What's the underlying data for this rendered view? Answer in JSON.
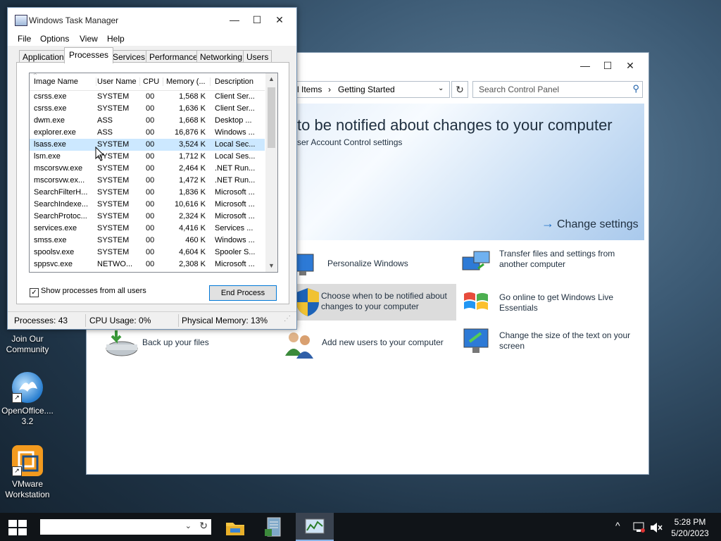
{
  "desktop": {
    "icons": [
      {
        "label": "Join Our\nCommunity",
        "line1": "Join Our",
        "line2": "Community",
        "icon": "community-icon"
      },
      {
        "label": "OpenOffice.org 3.2",
        "line1": "OpenOffice....",
        "line2": "3.2",
        "icon": "openoffice-icon"
      },
      {
        "label": "VMware Workstation",
        "line1": "VMware",
        "line2": "Workstation",
        "icon": "vmware-icon"
      }
    ]
  },
  "control_panel": {
    "breadcrumb_part1": "l Items",
    "breadcrumb_sep": "›",
    "breadcrumb_part2": "Getting Started",
    "search_placeholder": "Search Control Panel",
    "banner_headline": "to be notified about changes to your computer",
    "banner_sub": "ser Account Control settings",
    "change_settings": "Change settings",
    "tasks": {
      "personalize": "Personalize Windows",
      "transfer_1": "Transfer files and settings from",
      "transfer_2": "another computer",
      "uac_1": "Choose when to be notified about",
      "uac_2": "changes to your computer",
      "live_1": "Go online to get Windows Live",
      "live_2": "Essentials",
      "backup": "Back up your files",
      "users": "Add new users to your computer",
      "text_1": "Change the size of the text on your",
      "text_2": "screen"
    }
  },
  "task_manager": {
    "title": "Windows Task Manager",
    "menu": [
      "File",
      "Options",
      "View",
      "Help"
    ],
    "tabs": [
      "Applications",
      "Processes",
      "Services",
      "Performance",
      "Networking",
      "Users"
    ],
    "active_tab": "Processes",
    "columns": [
      "Image Name",
      "User Name",
      "CPU",
      "Memory (...",
      "Description"
    ],
    "rows": [
      [
        "csrss.exe",
        "SYSTEM",
        "00",
        "1,568 K",
        "Client Ser..."
      ],
      [
        "csrss.exe",
        "SYSTEM",
        "00",
        "1,636 K",
        "Client Ser..."
      ],
      [
        "dwm.exe",
        "ASS",
        "00",
        "1,668 K",
        "Desktop ..."
      ],
      [
        "explorer.exe",
        "ASS",
        "00",
        "16,876 K",
        "Windows ..."
      ],
      [
        "lsass.exe",
        "SYSTEM",
        "00",
        "3,524 K",
        "Local Sec..."
      ],
      [
        "lsm.exe",
        "SYSTEM",
        "00",
        "1,712 K",
        "Local Ses..."
      ],
      [
        "mscorsvw.exe",
        "SYSTEM",
        "00",
        "2,464 K",
        ".NET Run..."
      ],
      [
        "mscorsvw.ex...",
        "SYSTEM",
        "00",
        "1,472 K",
        ".NET Run..."
      ],
      [
        "SearchFilterH...",
        "SYSTEM",
        "00",
        "1,836 K",
        "Microsoft ..."
      ],
      [
        "SearchIndexe...",
        "SYSTEM",
        "00",
        "10,616 K",
        "Microsoft ..."
      ],
      [
        "SearchProtoc...",
        "SYSTEM",
        "00",
        "2,324 K",
        "Microsoft ..."
      ],
      [
        "services.exe",
        "SYSTEM",
        "00",
        "4,416 K",
        "Services ..."
      ],
      [
        "smss.exe",
        "SYSTEM",
        "00",
        "460 K",
        "Windows ..."
      ],
      [
        "spoolsv.exe",
        "SYSTEM",
        "00",
        "4,604 K",
        "Spooler S..."
      ],
      [
        "sppsvc.exe",
        "NETWO...",
        "00",
        "2,308 K",
        "Microsoft ..."
      ]
    ],
    "selected_row": 4,
    "show_all_label": "Show processes from all users",
    "show_all_checked": true,
    "end_process": "End Process",
    "status": {
      "processes": "Processes: 43",
      "cpu": "CPU Usage: 0%",
      "memory": "Physical Memory: 13%"
    }
  },
  "taskbar": {
    "clock_time": "5:28 PM",
    "clock_date": "5/20/2023",
    "apps": [
      "file-explorer-icon",
      "notepad-icon",
      "task-manager-icon"
    ]
  }
}
